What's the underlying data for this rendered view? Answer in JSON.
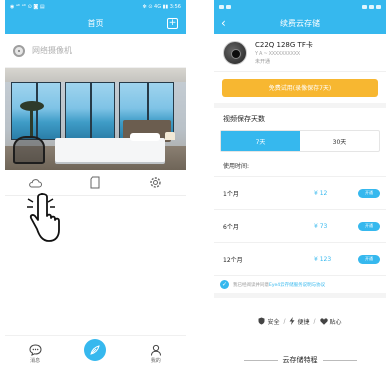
{
  "left": {
    "status": {
      "left": "◉ ᵃᵗˡ ᵃᵗˡ ⊙ ◙ ▤",
      "right": "✻ ⊙ 4G ▮▮ 3:56"
    },
    "nav": {
      "title": "首页",
      "add_icon": "plus-square-icon"
    },
    "camera": {
      "name": "网络摄像机"
    },
    "tools": [
      "cloud-icon",
      "sd-card-icon",
      "settings-gear-icon"
    ],
    "tabs": [
      {
        "label": "消息",
        "icon": "message-icon"
      },
      {
        "label": "",
        "icon": "feather-icon"
      },
      {
        "label": "我的",
        "icon": "user-icon"
      }
    ]
  },
  "right": {
    "nav": {
      "title": "续费云存储"
    },
    "device": {
      "name": "C22Q 128G TF卡",
      "id": "Y A ~ XXXXXXXXXX",
      "status": "未开通"
    },
    "trial_button": "免费试用(录像保存7天)",
    "storage_days_title": "视频保存天数",
    "day_options": [
      "7天",
      "30天"
    ],
    "usage_label": "使用时间:",
    "plans": [
      {
        "name": "1个月",
        "price": "¥ 12",
        "button": "开通"
      },
      {
        "name": "6个月",
        "price": "¥ 73",
        "button": "开通"
      },
      {
        "name": "12个月",
        "price": "¥ 123",
        "button": "开通"
      }
    ],
    "agree": {
      "prefix": "我已经阅读并同意",
      "link": "Eye4云存储服务说明与协议"
    },
    "features": [
      "安全",
      "便捷",
      "贴心"
    ],
    "cloud_feature_title": "云存储特程"
  },
  "colors": {
    "accent": "#36b8ee",
    "trial": "#f7b731"
  }
}
